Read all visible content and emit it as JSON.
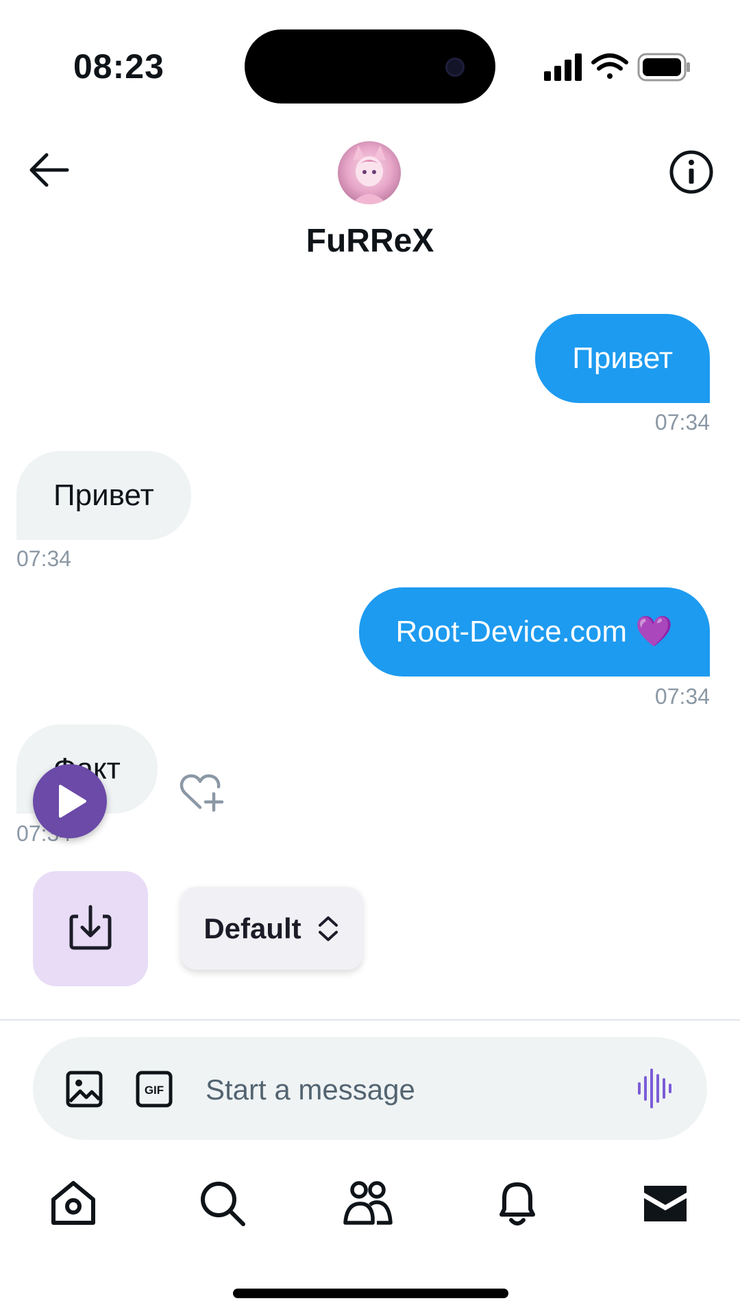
{
  "status_bar": {
    "time": "08:23"
  },
  "header": {
    "contact_name": "FuRReX"
  },
  "messages": [
    {
      "direction": "out",
      "text": "Привет",
      "time": "07:34"
    },
    {
      "direction": "in",
      "text": "Привет",
      "time": "07:34"
    },
    {
      "direction": "out",
      "text": "Root-Device.com 💜",
      "time": "07:34"
    },
    {
      "direction": "in",
      "text": "Факт",
      "time": "07:34"
    }
  ],
  "overlay": {
    "quality_label": "Default"
  },
  "composer": {
    "placeholder": "Start a message"
  },
  "colors": {
    "accent": "#1d9bf0",
    "incoming_bubble": "#eff3f4",
    "play_button": "#6b4aa8",
    "download_bg": "#e8dcf6",
    "voice_icon": "#7c5cd6"
  },
  "icons": {
    "back": "arrow-left-icon",
    "info": "info-icon",
    "react": "heart-plus-icon",
    "play": "play-icon",
    "download": "download-icon",
    "selector": "chevron-updown-icon",
    "media": "image-icon",
    "gif": "gif-icon",
    "voice": "voice-wave-icon",
    "nav": [
      "home-icon",
      "search-icon",
      "people-icon",
      "bell-icon",
      "mail-icon"
    ]
  }
}
